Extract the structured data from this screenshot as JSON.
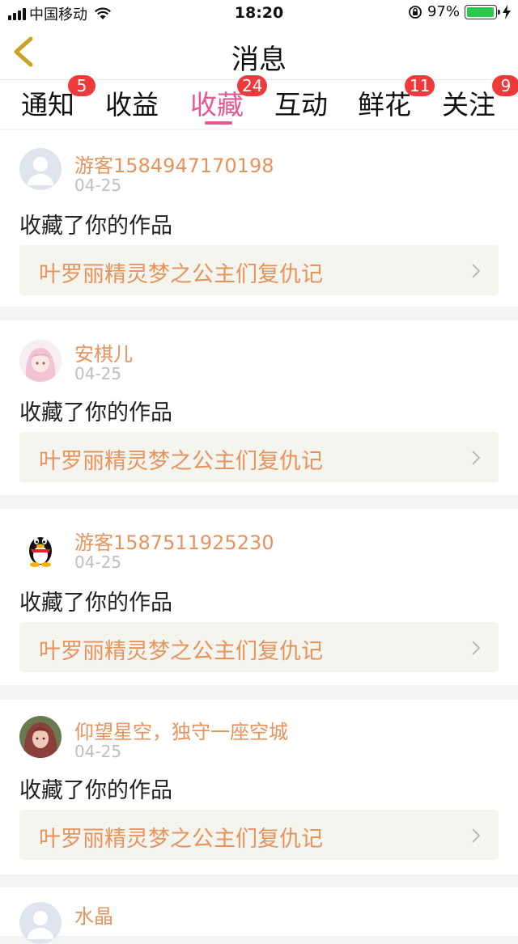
{
  "status_bar": {
    "carrier": "中国移动",
    "time": "18:20",
    "battery_percent": "97%",
    "battery_level": 0.97,
    "icons": [
      "signal-icon",
      "wifi-icon",
      "orientation-lock-icon",
      "battery-icon",
      "charging-icon"
    ]
  },
  "nav": {
    "title": "消息",
    "back_icon": "chevron-left-icon"
  },
  "tabs": [
    {
      "label": "通知",
      "badge": "5",
      "active": false
    },
    {
      "label": "收益",
      "badge": "",
      "active": false
    },
    {
      "label": "收藏",
      "badge": "24",
      "active": true
    },
    {
      "label": "互动",
      "badge": "",
      "active": false
    },
    {
      "label": "鲜花",
      "badge": "11",
      "active": false
    },
    {
      "label": "关注",
      "badge": "9",
      "active": false
    }
  ],
  "colors": {
    "accent": "#e8578f",
    "username": "#e8925c",
    "badge": "#ee3a3a"
  },
  "items": [
    {
      "username": "游客1584947170198",
      "date": "04-25",
      "action": "收藏了你的作品",
      "work_title": "叶罗丽精灵梦之公主们复仇记",
      "avatar": "default-avatar-icon"
    },
    {
      "username": "安棋儿",
      "date": "04-25",
      "action": "收藏了你的作品",
      "work_title": "叶罗丽精灵梦之公主们复仇记",
      "avatar": "anime-girl-avatar"
    },
    {
      "username": "游客1587511925230",
      "date": "04-25",
      "action": "收藏了你的作品",
      "work_title": "叶罗丽精灵梦之公主们复仇记",
      "avatar": "penguin-avatar"
    },
    {
      "username": "仰望星空，独守一座空城",
      "date": "04-25",
      "action": "收藏了你的作品",
      "work_title": "叶罗丽精灵梦之公主们复仇记",
      "avatar": "girl-photo-avatar"
    },
    {
      "username": "水晶",
      "date": "",
      "action": "",
      "work_title": "",
      "avatar": "default-avatar-icon"
    }
  ]
}
